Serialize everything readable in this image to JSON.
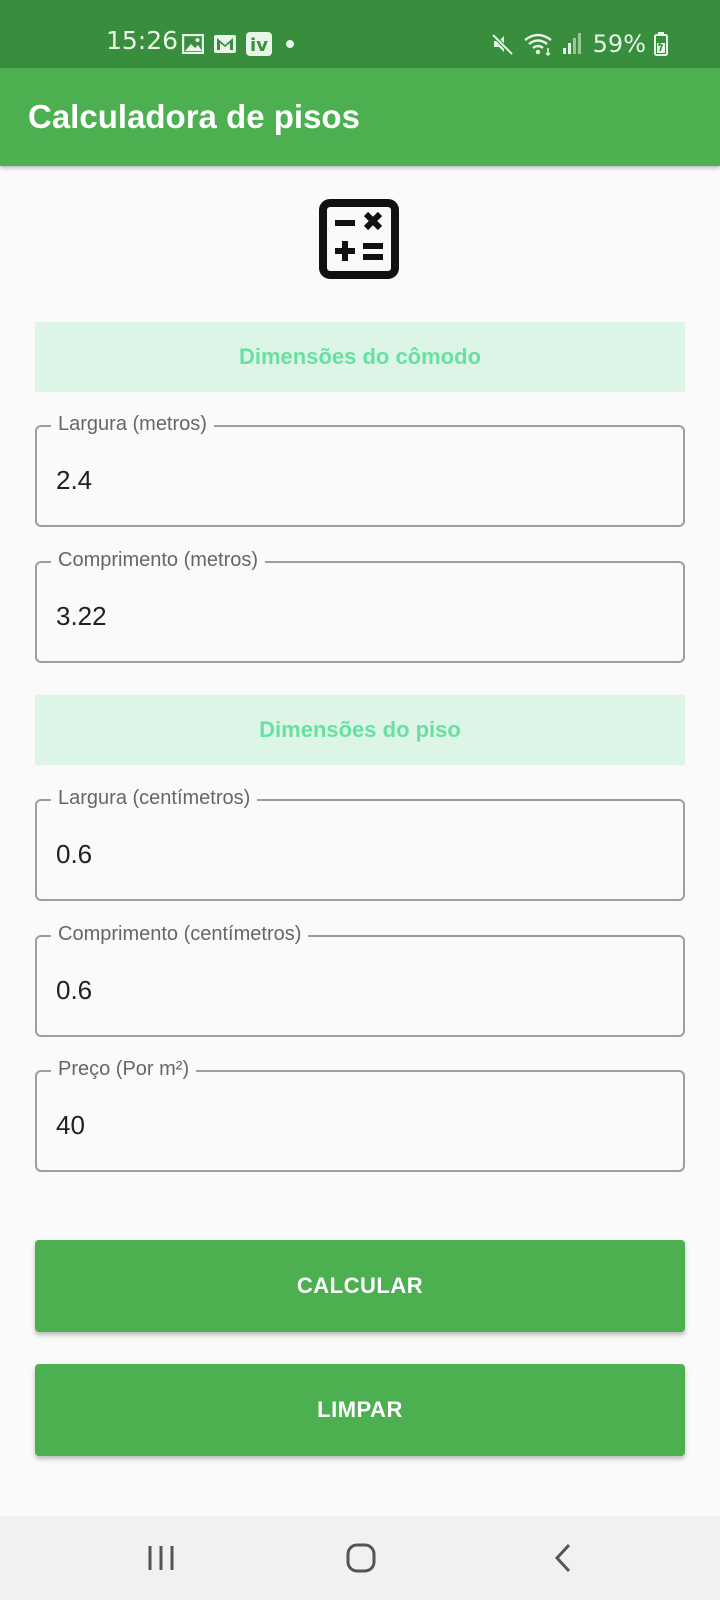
{
  "status_bar": {
    "time": "15:26",
    "notification_icons": [
      "image-icon",
      "gmail-icon",
      "iv-app-icon",
      "dot-icon"
    ],
    "iv_label": "iv",
    "system_icons": [
      "mute-icon",
      "wifi-icon",
      "signal-icon",
      "battery-icon"
    ],
    "battery_percent": "59%"
  },
  "app_bar": {
    "title": "Calculadora de pisos"
  },
  "header_icon": "calculator-icon",
  "sections": {
    "room": {
      "title": "Dimensões do cômodo",
      "width": {
        "label": "Largura (metros)",
        "value": "2.4"
      },
      "length": {
        "label": "Comprimento (metros)",
        "value": "3.22"
      }
    },
    "tile": {
      "title": "Dimensões do piso",
      "width": {
        "label": "Largura (centímetros)",
        "value": "0.6"
      },
      "length": {
        "label": "Comprimento (centímetros)",
        "value": "0.6"
      }
    },
    "price": {
      "label": "Preço (Por m²)",
      "value": "40"
    }
  },
  "buttons": {
    "calculate": "CALCULAR",
    "clear": "LIMPAR"
  },
  "nav_bar": [
    "recent-apps-icon",
    "home-icon",
    "back-icon"
  ],
  "colors": {
    "status_bar": "#388e3c",
    "app_bar": "#4caf50",
    "section_bg": "#ddf5e7",
    "section_text": "#69e0a3",
    "button": "#4caf50"
  }
}
